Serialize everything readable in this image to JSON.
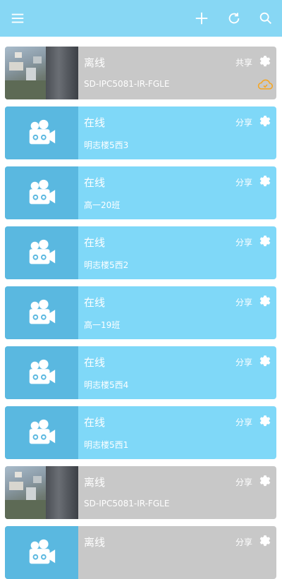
{
  "toolbar": {
    "menu_icon": "menu-icon",
    "add_icon": "plus-icon",
    "refresh_icon": "refresh-icon",
    "search_icon": "search-icon"
  },
  "colors": {
    "topbar": "#87d7f4",
    "online_card": "#7fd8f8",
    "offline_card": "#c8c8c8",
    "camera_tile": "#5ab8e0",
    "cloud_icon": "#f5a623"
  },
  "devices": [
    {
      "status": "离线",
      "name": "SD-IPC5081-IR-FGLE",
      "share": "共享",
      "state": "offline",
      "thumb": "photo",
      "cloud": true
    },
    {
      "status": "在线",
      "name": "明志楼5西3",
      "share": "分享",
      "state": "online",
      "thumb": "camera"
    },
    {
      "status": "在线",
      "name": "高一20班",
      "share": "分享",
      "state": "online",
      "thumb": "camera"
    },
    {
      "status": "在线",
      "name": "明志楼5西2",
      "share": "分享",
      "state": "online",
      "thumb": "camera"
    },
    {
      "status": "在线",
      "name": "高一19班",
      "share": "分享",
      "state": "online",
      "thumb": "camera"
    },
    {
      "status": "在线",
      "name": "明志楼5西4",
      "share": "分享",
      "state": "online",
      "thumb": "camera"
    },
    {
      "status": "在线",
      "name": "明志楼5西1",
      "share": "分享",
      "state": "online",
      "thumb": "camera"
    },
    {
      "status": "离线",
      "name": "SD-IPC5081-IR-FGLE",
      "share": "分享",
      "state": "offline",
      "thumb": "photo"
    },
    {
      "status": "离线",
      "name": "",
      "share": "分享",
      "state": "offline",
      "thumb": "camera"
    }
  ]
}
